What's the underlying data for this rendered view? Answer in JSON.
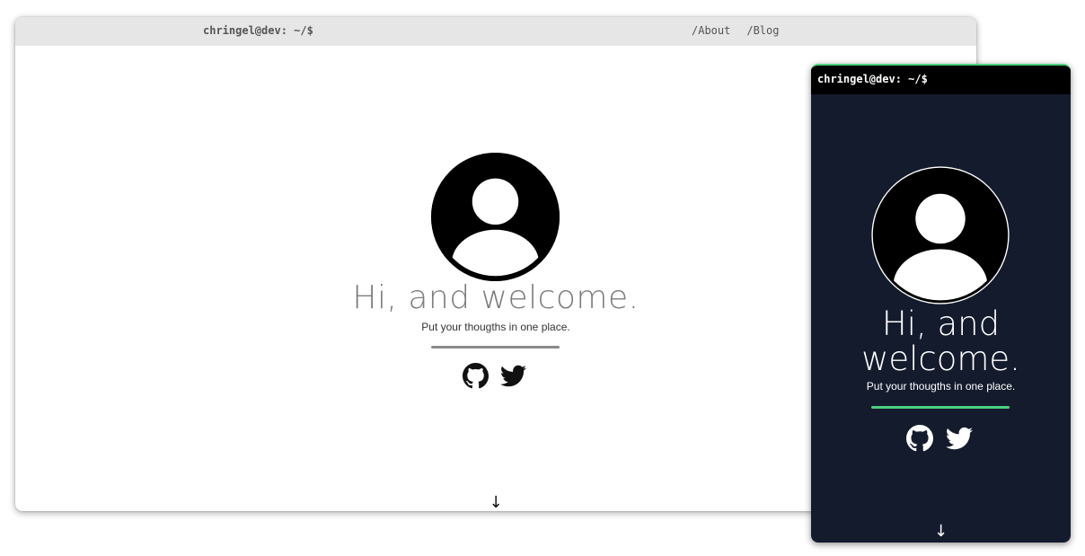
{
  "desktop": {
    "prompt": "chringel@dev: ~/$",
    "nav": {
      "about": "/About",
      "blog": "/Blog"
    },
    "hero": {
      "title": "Hi, and welcome.",
      "subtitle": "Put your thougths in one place."
    },
    "social": [
      "github-icon",
      "twitter-icon"
    ],
    "scroll_hint": "↓",
    "colors": {
      "topbar": "#e6e6e6",
      "background": "#ffffff",
      "title": "#7c7c7c",
      "divider": "#8a8a8a"
    }
  },
  "mobile": {
    "prompt": "chringel@dev: ~/$",
    "hero": {
      "title_line1": "Hi, and",
      "title_line2": "welcome.",
      "subtitle": "Put your thougths in one place."
    },
    "social": [
      "github-icon",
      "twitter-icon"
    ],
    "scroll_hint": "↓",
    "colors": {
      "topbar": "#000000",
      "background": "#141b2d",
      "title": "#ffffff",
      "accent": "#4cd07d"
    }
  }
}
